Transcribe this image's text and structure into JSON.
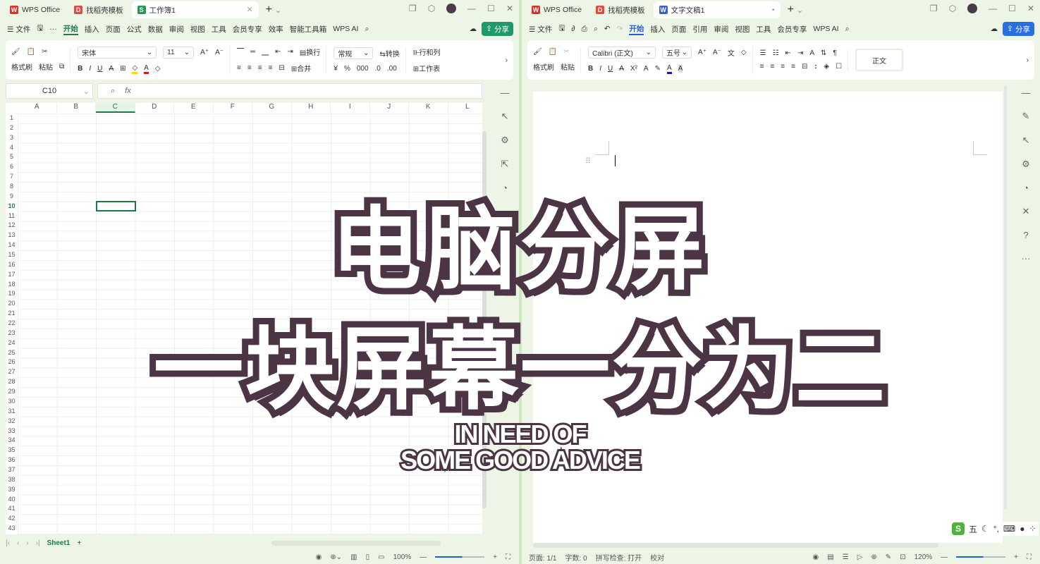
{
  "left": {
    "tabs": [
      {
        "label": "WPS Office",
        "icon": "wps-logo"
      },
      {
        "label": "找稻壳模板",
        "icon": "docer-icon"
      },
      {
        "label": "工作簿1",
        "icon": "spreadsheet-icon"
      }
    ],
    "menu": [
      "☰ 文件",
      "开始",
      "插入",
      "页面",
      "公式",
      "数据",
      "审阅",
      "视图",
      "工具",
      "会员专享",
      "效率",
      "智能工具箱",
      "WPS AI"
    ],
    "active_menu": "开始",
    "share": "分享",
    "ribbon": {
      "format_painter": "格式刷",
      "paste": "粘贴",
      "font": "宋体",
      "size": "11",
      "wrap": "换行",
      "number_format": "常规",
      "convert": "转换",
      "merge": "合并",
      "rowcol": "行和列",
      "worksheet": "工作表"
    },
    "namebox": "C10",
    "fx": "fx",
    "columns": [
      "A",
      "B",
      "C",
      "D",
      "E",
      "F",
      "G",
      "H",
      "I",
      "J",
      "K",
      "L"
    ],
    "selected_col": "C",
    "selected_row": 10,
    "sheet_tab": "Sheet1",
    "zoom": "100%",
    "accent": "#1f7a47"
  },
  "right": {
    "tabs": [
      {
        "label": "WPS Office",
        "icon": "wps-logo"
      },
      {
        "label": "找稻壳模板",
        "icon": "docer-icon"
      },
      {
        "label": "文字文稿1",
        "icon": "writer-icon"
      }
    ],
    "menu": [
      "☰ 文件",
      "开始",
      "插入",
      "页面",
      "引用",
      "审阅",
      "视图",
      "工具",
      "会员专享",
      "WPS AI"
    ],
    "active_menu": "开始",
    "share": "分享",
    "ribbon": {
      "format_painter": "格式刷",
      "paste": "粘贴",
      "font": "Calibri (正文)",
      "size": "五号",
      "style": "正文"
    },
    "status": {
      "page": "页面: 1/1",
      "words": "字数: 0",
      "spell": "拼写检查: 打开",
      "proof": "校对",
      "zoom": "120%"
    },
    "ime": "五",
    "accent": "#2a5bd7"
  },
  "overlay": {
    "line1": "电脑分屏",
    "line2": "一块屏幕一分为二",
    "eng1": "IN NEED OF",
    "eng2": "SOME GOOD ADVICE",
    "stroke_color": "#4b3545"
  }
}
